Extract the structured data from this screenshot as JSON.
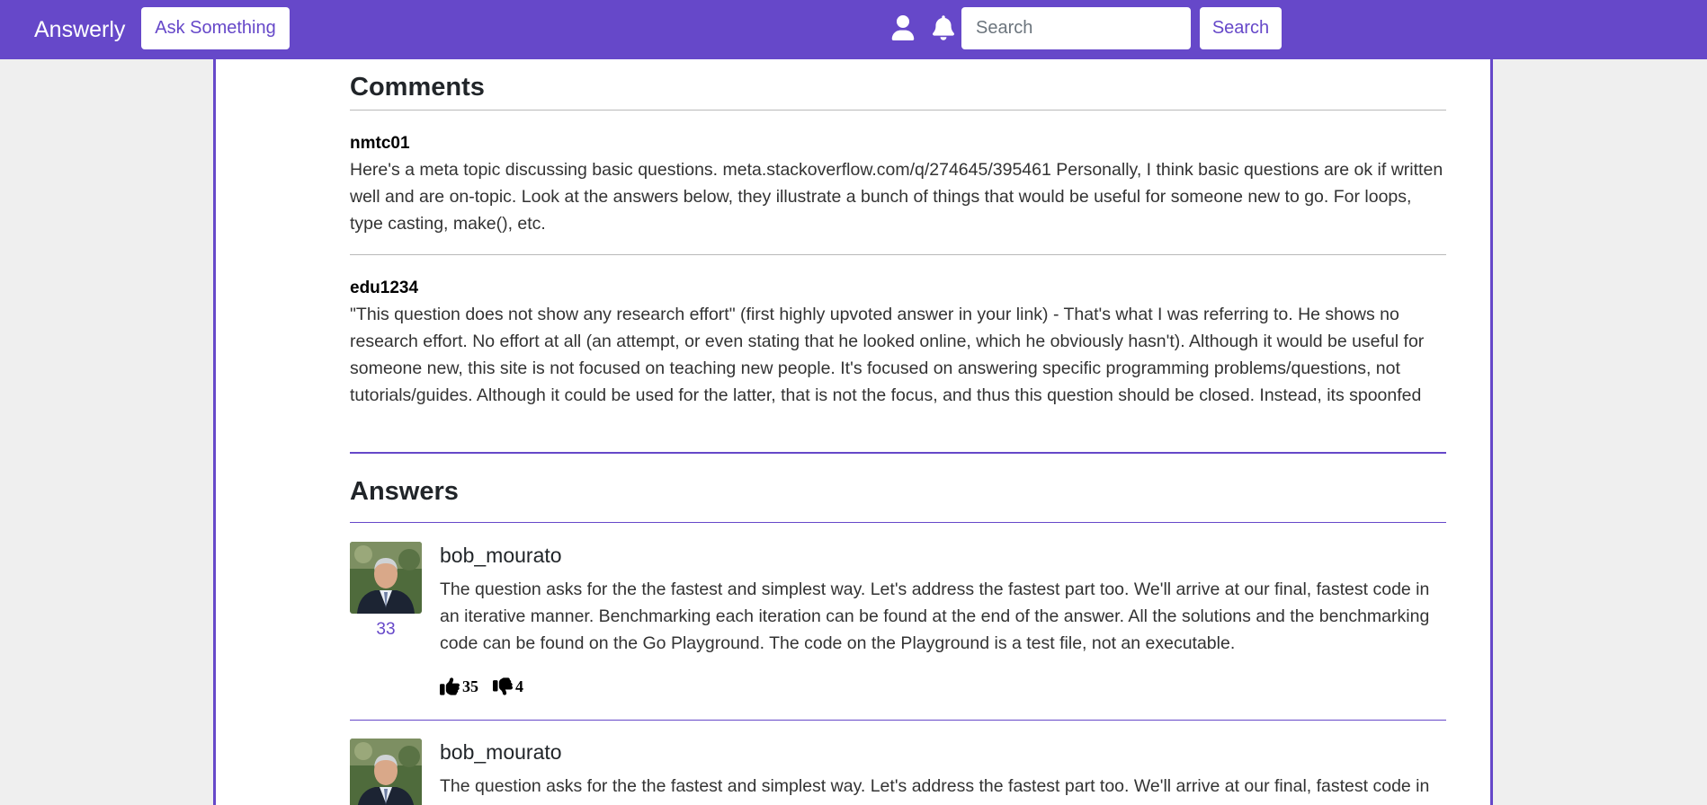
{
  "navbar": {
    "brand": "Answerly",
    "ask_label": "Ask Something",
    "search_placeholder": "Search",
    "search_button": "Search",
    "user_icon": "user-icon",
    "bell_icon": "bell-icon"
  },
  "comments": {
    "title": "Comments",
    "items": [
      {
        "author": "nmtc01",
        "text": "Here's a meta topic discussing basic questions. meta.stackoverflow.com/q/274645/395461 Personally, I think basic questions are ok if written well and are on-topic. Look at the answers below, they illustrate a bunch of things that would be useful for someone new to go. For loops, type casting, make(), etc."
      },
      {
        "author": "edu1234",
        "text": "\"This question does not show any research effort\" (first highly upvoted answer in your link) - That's what I was referring to. He shows no research effort. No effort at all (an attempt, or even stating that he looked online, which he obviously hasn't). Although it would be useful for someone new, this site is not focused on teaching new people. It's focused on answering specific programming problems/questions, not tutorials/guides. Although it could be used for the latter, that is not the focus, and thus this question should be closed. Instead, its spoonfed"
      }
    ]
  },
  "answers": {
    "title": "Answers",
    "items": [
      {
        "author": "bob_mourato",
        "score": "33",
        "text": "The question asks for the the fastest and simplest way. Let's address the fastest part too. We'll arrive at our final, fastest code in an iterative manner. Benchmarking each iteration can be found at the end of the answer. All the solutions and the benchmarking code can be found on the Go Playground. The code on the Playground is a test file, not an executable.",
        "upvotes": "35",
        "downvotes": "4"
      },
      {
        "author": "bob_mourato",
        "text": "The question asks for the the fastest and simplest way. Let's address the fastest part too. We'll arrive at our final, fastest code in"
      }
    ]
  },
  "colors": {
    "accent": "#6648c9",
    "background": "#efefef"
  }
}
